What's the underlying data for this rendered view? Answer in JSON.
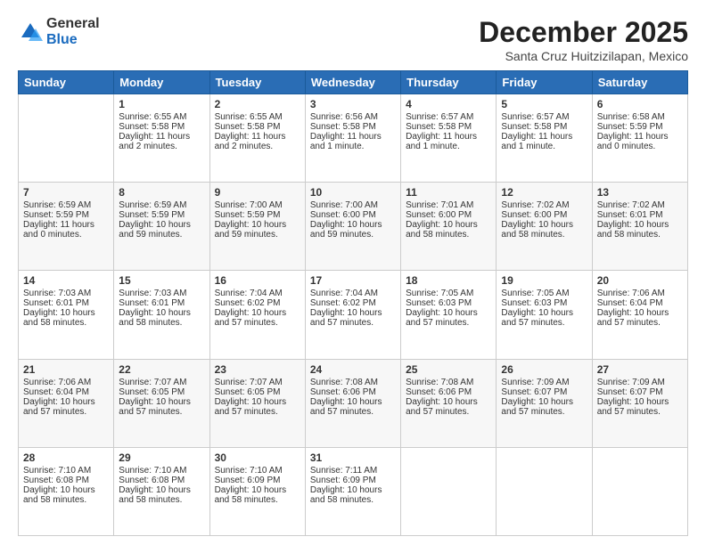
{
  "logo": {
    "general": "General",
    "blue": "Blue"
  },
  "title": "December 2025",
  "location": "Santa Cruz Huitzizilapan, Mexico",
  "days_of_week": [
    "Sunday",
    "Monday",
    "Tuesday",
    "Wednesday",
    "Thursday",
    "Friday",
    "Saturday"
  ],
  "weeks": [
    [
      {
        "num": "",
        "content": ""
      },
      {
        "num": "1",
        "content": "Sunrise: 6:55 AM\nSunset: 5:58 PM\nDaylight: 11 hours\nand 2 minutes."
      },
      {
        "num": "2",
        "content": "Sunrise: 6:55 AM\nSunset: 5:58 PM\nDaylight: 11 hours\nand 2 minutes."
      },
      {
        "num": "3",
        "content": "Sunrise: 6:56 AM\nSunset: 5:58 PM\nDaylight: 11 hours\nand 1 minute."
      },
      {
        "num": "4",
        "content": "Sunrise: 6:57 AM\nSunset: 5:58 PM\nDaylight: 11 hours\nand 1 minute."
      },
      {
        "num": "5",
        "content": "Sunrise: 6:57 AM\nSunset: 5:58 PM\nDaylight: 11 hours\nand 1 minute."
      },
      {
        "num": "6",
        "content": "Sunrise: 6:58 AM\nSunset: 5:59 PM\nDaylight: 11 hours\nand 0 minutes."
      }
    ],
    [
      {
        "num": "7",
        "content": "Sunrise: 6:59 AM\nSunset: 5:59 PM\nDaylight: 11 hours\nand 0 minutes."
      },
      {
        "num": "8",
        "content": "Sunrise: 6:59 AM\nSunset: 5:59 PM\nDaylight: 10 hours\nand 59 minutes."
      },
      {
        "num": "9",
        "content": "Sunrise: 7:00 AM\nSunset: 5:59 PM\nDaylight: 10 hours\nand 59 minutes."
      },
      {
        "num": "10",
        "content": "Sunrise: 7:00 AM\nSunset: 6:00 PM\nDaylight: 10 hours\nand 59 minutes."
      },
      {
        "num": "11",
        "content": "Sunrise: 7:01 AM\nSunset: 6:00 PM\nDaylight: 10 hours\nand 58 minutes."
      },
      {
        "num": "12",
        "content": "Sunrise: 7:02 AM\nSunset: 6:00 PM\nDaylight: 10 hours\nand 58 minutes."
      },
      {
        "num": "13",
        "content": "Sunrise: 7:02 AM\nSunset: 6:01 PM\nDaylight: 10 hours\nand 58 minutes."
      }
    ],
    [
      {
        "num": "14",
        "content": "Sunrise: 7:03 AM\nSunset: 6:01 PM\nDaylight: 10 hours\nand 58 minutes."
      },
      {
        "num": "15",
        "content": "Sunrise: 7:03 AM\nSunset: 6:01 PM\nDaylight: 10 hours\nand 58 minutes."
      },
      {
        "num": "16",
        "content": "Sunrise: 7:04 AM\nSunset: 6:02 PM\nDaylight: 10 hours\nand 57 minutes."
      },
      {
        "num": "17",
        "content": "Sunrise: 7:04 AM\nSunset: 6:02 PM\nDaylight: 10 hours\nand 57 minutes."
      },
      {
        "num": "18",
        "content": "Sunrise: 7:05 AM\nSunset: 6:03 PM\nDaylight: 10 hours\nand 57 minutes."
      },
      {
        "num": "19",
        "content": "Sunrise: 7:05 AM\nSunset: 6:03 PM\nDaylight: 10 hours\nand 57 minutes."
      },
      {
        "num": "20",
        "content": "Sunrise: 7:06 AM\nSunset: 6:04 PM\nDaylight: 10 hours\nand 57 minutes."
      }
    ],
    [
      {
        "num": "21",
        "content": "Sunrise: 7:06 AM\nSunset: 6:04 PM\nDaylight: 10 hours\nand 57 minutes."
      },
      {
        "num": "22",
        "content": "Sunrise: 7:07 AM\nSunset: 6:05 PM\nDaylight: 10 hours\nand 57 minutes."
      },
      {
        "num": "23",
        "content": "Sunrise: 7:07 AM\nSunset: 6:05 PM\nDaylight: 10 hours\nand 57 minutes."
      },
      {
        "num": "24",
        "content": "Sunrise: 7:08 AM\nSunset: 6:06 PM\nDaylight: 10 hours\nand 57 minutes."
      },
      {
        "num": "25",
        "content": "Sunrise: 7:08 AM\nSunset: 6:06 PM\nDaylight: 10 hours\nand 57 minutes."
      },
      {
        "num": "26",
        "content": "Sunrise: 7:09 AM\nSunset: 6:07 PM\nDaylight: 10 hours\nand 57 minutes."
      },
      {
        "num": "27",
        "content": "Sunrise: 7:09 AM\nSunset: 6:07 PM\nDaylight: 10 hours\nand 57 minutes."
      }
    ],
    [
      {
        "num": "28",
        "content": "Sunrise: 7:10 AM\nSunset: 6:08 PM\nDaylight: 10 hours\nand 58 minutes."
      },
      {
        "num": "29",
        "content": "Sunrise: 7:10 AM\nSunset: 6:08 PM\nDaylight: 10 hours\nand 58 minutes."
      },
      {
        "num": "30",
        "content": "Sunrise: 7:10 AM\nSunset: 6:09 PM\nDaylight: 10 hours\nand 58 minutes."
      },
      {
        "num": "31",
        "content": "Sunrise: 7:11 AM\nSunset: 6:09 PM\nDaylight: 10 hours\nand 58 minutes."
      },
      {
        "num": "",
        "content": ""
      },
      {
        "num": "",
        "content": ""
      },
      {
        "num": "",
        "content": ""
      }
    ]
  ]
}
